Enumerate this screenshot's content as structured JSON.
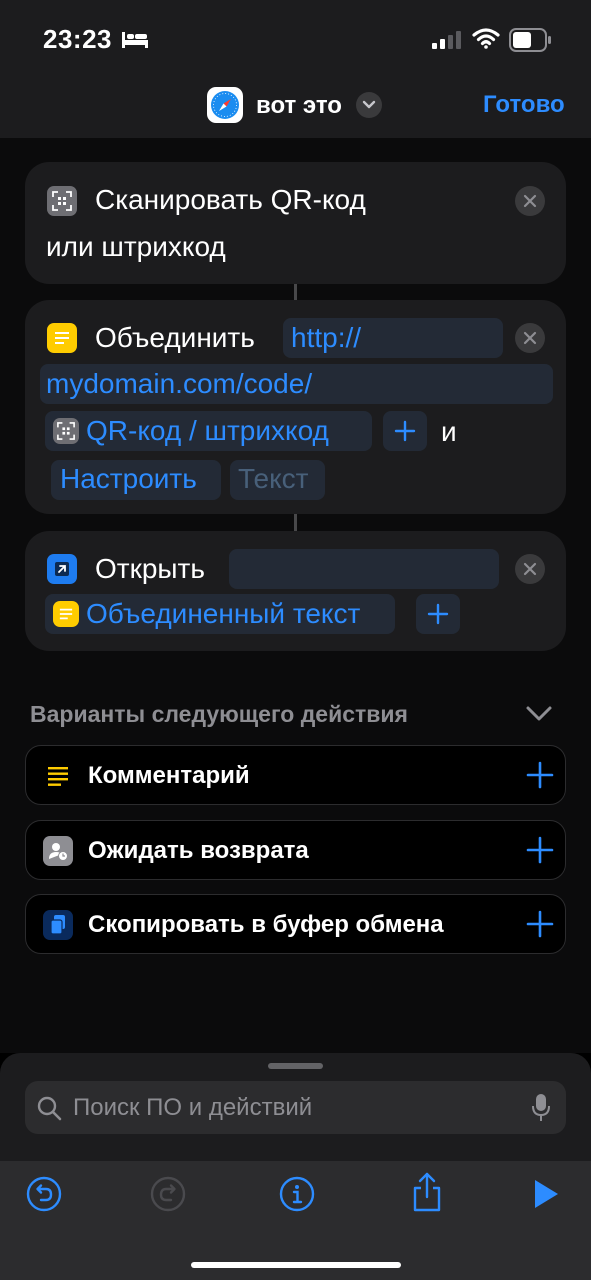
{
  "status_bar": {
    "time": "23:23",
    "icons": [
      "bed-icon",
      "cellular-signal-icon",
      "wifi-icon",
      "battery-icon"
    ]
  },
  "header": {
    "app_icon": "safari-compass-icon",
    "title": "вот это",
    "done_label": "Готово",
    "accent_color": "#2d8cff"
  },
  "actions": [
    {
      "icon": "qr-scan-icon",
      "line1": "Сканировать QR-код",
      "line2": "или штрихкод"
    },
    {
      "icon": "text-lines-icon",
      "icon_color": "#ffcc00",
      "label": "Объединить",
      "token_url_1": "http://",
      "token_url_2": "mydomain.com/code/",
      "token_variable": "QR-код / штрихкод",
      "and_label": "и",
      "configure_label": "Настроить",
      "text_placeholder": "Текст"
    },
    {
      "icon": "open-arrow-icon",
      "icon_color": "#1e7cf0",
      "label": "Открыть",
      "token_variable": "Объединенный текст"
    }
  ],
  "suggestions": {
    "header": "Варианты следующего действия",
    "items": [
      {
        "label": "Комментарий",
        "icon": "comment-lines-icon"
      },
      {
        "label": "Ожидать возврата",
        "icon": "wait-return-icon"
      },
      {
        "label": "Скопировать в буфер обмена",
        "icon": "clipboard-icon"
      }
    ]
  },
  "search": {
    "placeholder": "Поиск ПО и действий"
  },
  "toolbar": {
    "buttons": [
      "undo-icon",
      "redo-icon",
      "info-icon",
      "share-icon",
      "play-icon"
    ]
  }
}
